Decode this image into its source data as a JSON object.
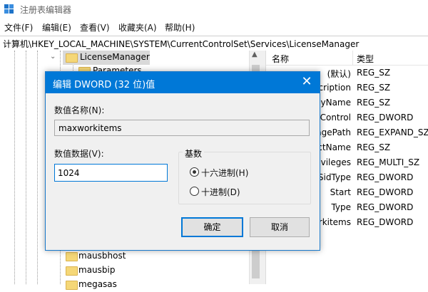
{
  "window": {
    "title": "注册表编辑器"
  },
  "menu": [
    "文件(F)",
    "编辑(E)",
    "查看(V)",
    "收藏夹(A)",
    "帮助(H)"
  ],
  "address": "计算机\\HKEY_LOCAL_MACHINE\\SYSTEM\\CurrentControlSet\\Services\\LicenseManager",
  "tree": {
    "selected": "LicenseManager",
    "child_partial": "Parameters",
    "items_below": [
      "mausbhost",
      "mausbip",
      "megasas"
    ]
  },
  "list": {
    "headers": {
      "name": "名称",
      "type": "类型"
    },
    "rows": [
      {
        "name": "(默认)",
        "type": "REG_SZ"
      },
      {
        "name": "Description",
        "type": "REG_SZ"
      },
      {
        "name": "DisplayName",
        "type": "REG_SZ"
      },
      {
        "name": "ErrorControl",
        "type": "REG_DWORD"
      },
      {
        "name": "ImagePath",
        "type": "REG_EXPAND_SZ"
      },
      {
        "name": "ObjectName",
        "type": "REG_SZ"
      },
      {
        "name": "RequiredPrivileges",
        "type": "REG_MULTI_SZ"
      },
      {
        "name": "ServiceSidType",
        "type": "REG_DWORD"
      },
      {
        "name": "Start",
        "type": "REG_DWORD"
      },
      {
        "name": "Type",
        "type": "REG_DWORD"
      },
      {
        "name": "maxworkitems",
        "type": "REG_DWORD"
      }
    ]
  },
  "dialog": {
    "title": "编辑 DWORD (32 位)值",
    "close_glyph": "✕",
    "name_label": "数值名称(N):",
    "name_value": "maxworkitems",
    "data_label": "数值数据(V):",
    "data_value": "1024",
    "base_label": "基数",
    "radio_hex": "十六进制(H)",
    "radio_dec": "十进制(D)",
    "selected_base": "hex",
    "ok": "确定",
    "cancel": "取消"
  },
  "colors": {
    "accent": "#0078d7",
    "folder": "#f5d777",
    "selection": "#d9d9d9"
  }
}
